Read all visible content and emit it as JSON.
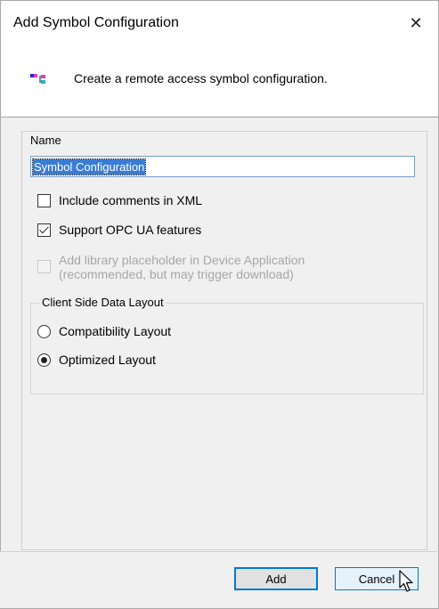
{
  "window": {
    "title": "Add Symbol Configuration",
    "close_glyph": "✕"
  },
  "header": {
    "description": "Create a remote access symbol configuration."
  },
  "form": {
    "name_label": "Name",
    "name_value": "Symbol Configuration",
    "include_comments": {
      "label": "Include comments in XML",
      "checked": false
    },
    "support_opc_ua": {
      "label": "Support OPC UA features",
      "checked": true
    },
    "add_library": {
      "line1": "Add library placeholder in Device Application",
      "line2": "(recommended, but may trigger download)",
      "checked": false,
      "enabled": false
    }
  },
  "layout_group": {
    "title": "Client Side Data Layout",
    "options": [
      {
        "label": "Compatibility Layout",
        "selected": false
      },
      {
        "label": "Optimized Layout",
        "selected": true
      }
    ]
  },
  "buttons": {
    "add": "Add",
    "cancel": "Cancel"
  },
  "colors": {
    "accent": "#0078d7",
    "selection": "#3a7bd5"
  }
}
